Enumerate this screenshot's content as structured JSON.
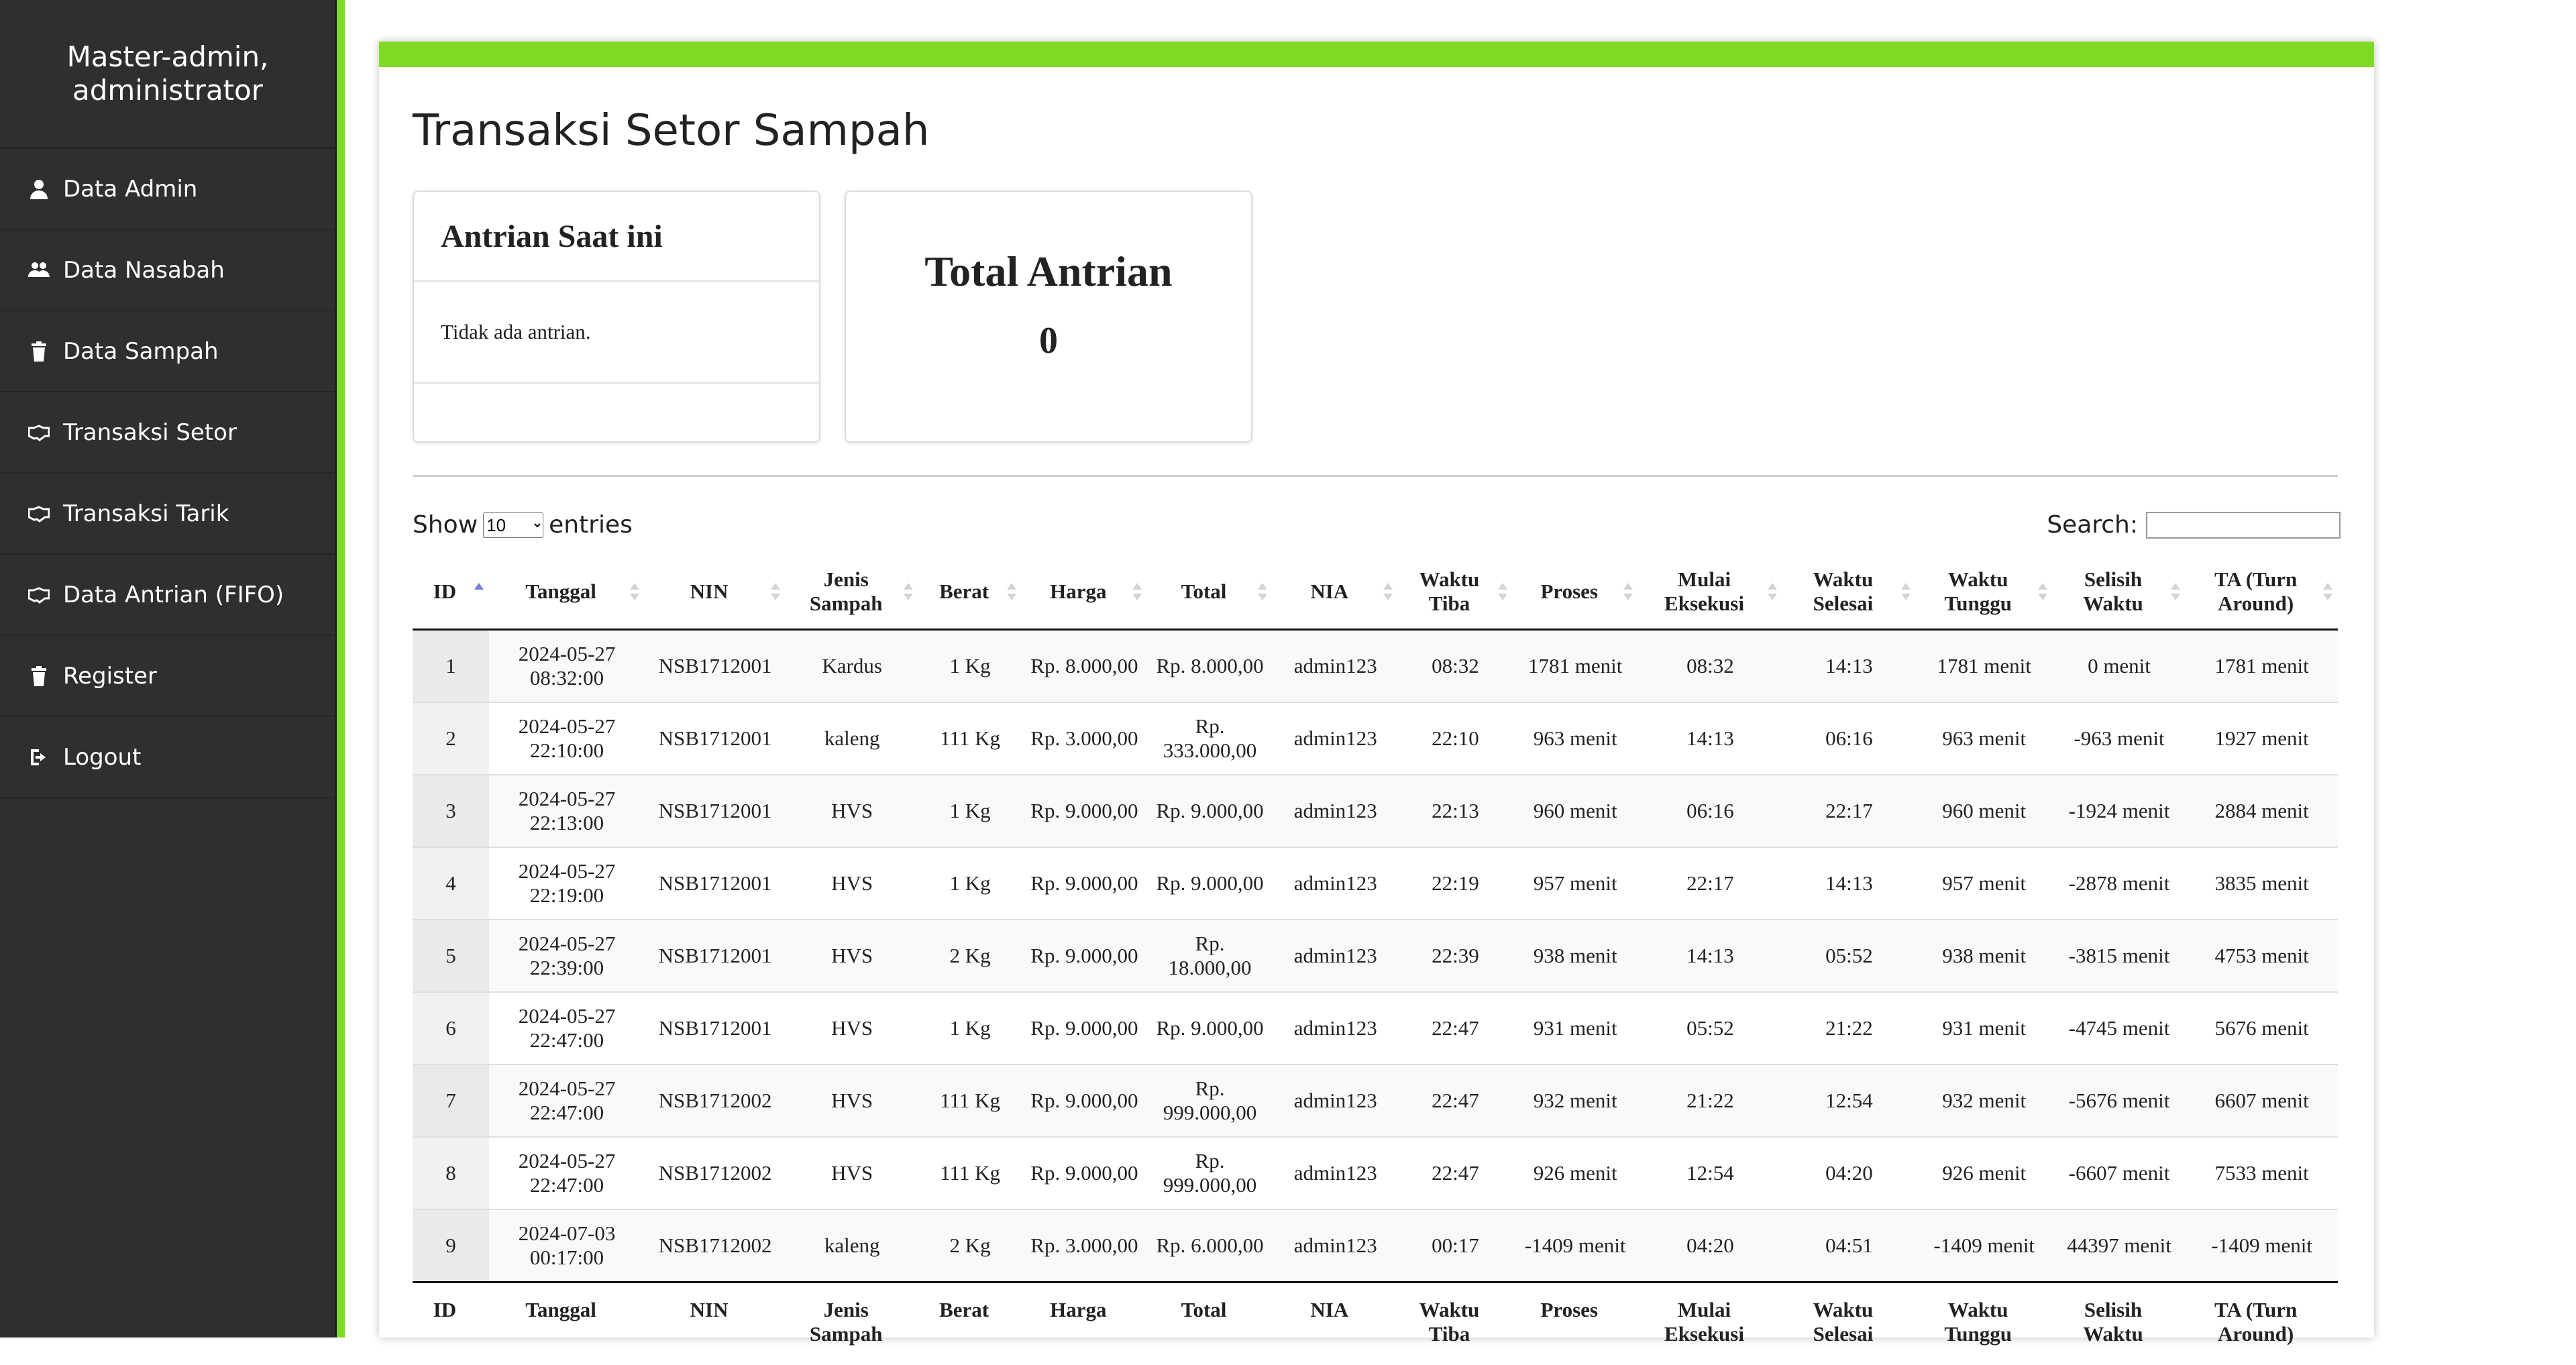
{
  "sidebar": {
    "user": "Master-admin, administrator",
    "items": [
      {
        "label": "Data Admin",
        "icon": "user-icon"
      },
      {
        "label": "Data Nasabah",
        "icon": "users-icon"
      },
      {
        "label": "Data Sampah",
        "icon": "trash-icon"
      },
      {
        "label": "Transaksi Setor",
        "icon": "handshake-icon"
      },
      {
        "label": "Transaksi Tarik",
        "icon": "handshake-icon"
      },
      {
        "label": "Data Antrian (FIFO)",
        "icon": "handshake-icon"
      },
      {
        "label": "Register",
        "icon": "trash-icon"
      },
      {
        "label": "Logout",
        "icon": "sign-out-icon"
      }
    ]
  },
  "colors": {
    "accent": "#7fda25",
    "sidebar": "#2f2f2f"
  },
  "page": {
    "title": "Transaksi Setor Sampah",
    "queue_title": "Antrian Saat ini",
    "queue_text": "Tidak ada antrian.",
    "total_title": "Total Antrian",
    "total_value": "0"
  },
  "controls": {
    "show_label": "Show",
    "entries_label": "entries",
    "page_size": "10",
    "search_label": "Search:",
    "search_value": ""
  },
  "table": {
    "headers": [
      "ID",
      "Tanggal",
      "NIN",
      "Jenis Sampah",
      "Berat",
      "Harga",
      "Total",
      "NIA",
      "Waktu Tiba",
      "Proses",
      "Mulai Eksekusi",
      "Waktu Selesai",
      "Waktu Tunggu",
      "Selisih Waktu",
      "TA (Turn Around)"
    ],
    "rows": [
      [
        "1",
        "2024-05-27 08:32:00",
        "NSB1712001",
        "Kardus",
        "1 Kg",
        "Rp. 8.000,00",
        "Rp. 8.000,00",
        "admin123",
        "08:32",
        "1781 menit",
        "08:32",
        "14:13",
        "1781 menit",
        "0 menit",
        "1781 menit"
      ],
      [
        "2",
        "2024-05-27 22:10:00",
        "NSB1712001",
        "kaleng",
        "111 Kg",
        "Rp. 3.000,00",
        "Rp. 333.000,00",
        "admin123",
        "22:10",
        "963 menit",
        "14:13",
        "06:16",
        "963 menit",
        "-963 menit",
        "1927 menit"
      ],
      [
        "3",
        "2024-05-27 22:13:00",
        "NSB1712001",
        "HVS",
        "1 Kg",
        "Rp. 9.000,00",
        "Rp. 9.000,00",
        "admin123",
        "22:13",
        "960 menit",
        "06:16",
        "22:17",
        "960 menit",
        "-1924 menit",
        "2884 menit"
      ],
      [
        "4",
        "2024-05-27 22:19:00",
        "NSB1712001",
        "HVS",
        "1 Kg",
        "Rp. 9.000,00",
        "Rp. 9.000,00",
        "admin123",
        "22:19",
        "957 menit",
        "22:17",
        "14:13",
        "957 menit",
        "-2878 menit",
        "3835 menit"
      ],
      [
        "5",
        "2024-05-27 22:39:00",
        "NSB1712001",
        "HVS",
        "2 Kg",
        "Rp. 9.000,00",
        "Rp. 18.000,00",
        "admin123",
        "22:39",
        "938 menit",
        "14:13",
        "05:52",
        "938 menit",
        "-3815 menit",
        "4753 menit"
      ],
      [
        "6",
        "2024-05-27 22:47:00",
        "NSB1712001",
        "HVS",
        "1 Kg",
        "Rp. 9.000,00",
        "Rp. 9.000,00",
        "admin123",
        "22:47",
        "931 menit",
        "05:52",
        "21:22",
        "931 menit",
        "-4745 menit",
        "5676 menit"
      ],
      [
        "7",
        "2024-05-27 22:47:00",
        "NSB1712002",
        "HVS",
        "111 Kg",
        "Rp. 9.000,00",
        "Rp. 999.000,00",
        "admin123",
        "22:47",
        "932 menit",
        "21:22",
        "12:54",
        "932 menit",
        "-5676 menit",
        "6607 menit"
      ],
      [
        "8",
        "2024-05-27 22:47:00",
        "NSB1712002",
        "HVS",
        "111 Kg",
        "Rp. 9.000,00",
        "Rp. 999.000,00",
        "admin123",
        "22:47",
        "926 menit",
        "12:54",
        "04:20",
        "926 menit",
        "-6607 menit",
        "7533 menit"
      ],
      [
        "9",
        "2024-07-03 00:17:00",
        "NSB1712002",
        "kaleng",
        "2 Kg",
        "Rp. 3.000,00",
        "Rp. 6.000,00",
        "admin123",
        "00:17",
        "-1409 menit",
        "04:20",
        "04:51",
        "-1409 menit",
        "44397 menit",
        "-1409 menit"
      ]
    ]
  }
}
